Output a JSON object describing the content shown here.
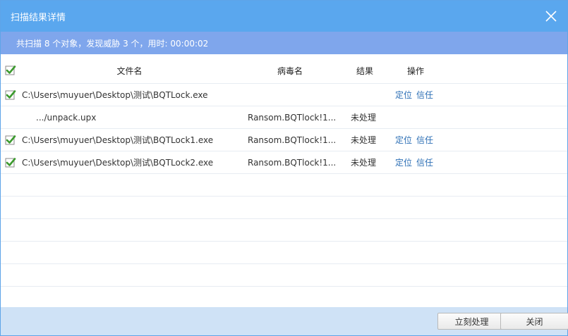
{
  "window": {
    "title": "扫描结果详情"
  },
  "summary": {
    "text": "共扫描 8 个对象，发现威胁 3 个，用时: 00:00:02"
  },
  "table": {
    "columns": {
      "file": "文件名",
      "virus": "病毒名",
      "result": "结果",
      "action": "操作"
    },
    "rows": [
      {
        "checked": true,
        "file": "C:\\Users\\muyuer\\Desktop\\测试\\BQTLock.exe",
        "virus": "",
        "result": "",
        "locate": "定位",
        "trust": "信任"
      },
      {
        "checked": false,
        "file": ".../unpack.upx",
        "virus": "Ransom.BQTlock!1....",
        "result": "未处理",
        "locate": "",
        "trust": ""
      },
      {
        "checked": true,
        "file": "C:\\Users\\muyuer\\Desktop\\测试\\BQTLock1.exe",
        "virus": "Ransom.BQTlock!1....",
        "result": "未处理",
        "locate": "定位",
        "trust": "信任"
      },
      {
        "checked": true,
        "file": "C:\\Users\\muyuer\\Desktop\\测试\\BQTLock2.exe",
        "virus": "Ransom.BQTlock!1....",
        "result": "未处理",
        "locate": "定位",
        "trust": "信任"
      }
    ]
  },
  "footer": {
    "process_label": "立刻处理",
    "close_label": "关闭"
  },
  "colors": {
    "titlebar": "#5aa7ee",
    "summary_bar": "#7fa6ec",
    "link": "#2d6fb5",
    "footer": "#cfe2f6",
    "check": "#3c9a2e"
  }
}
